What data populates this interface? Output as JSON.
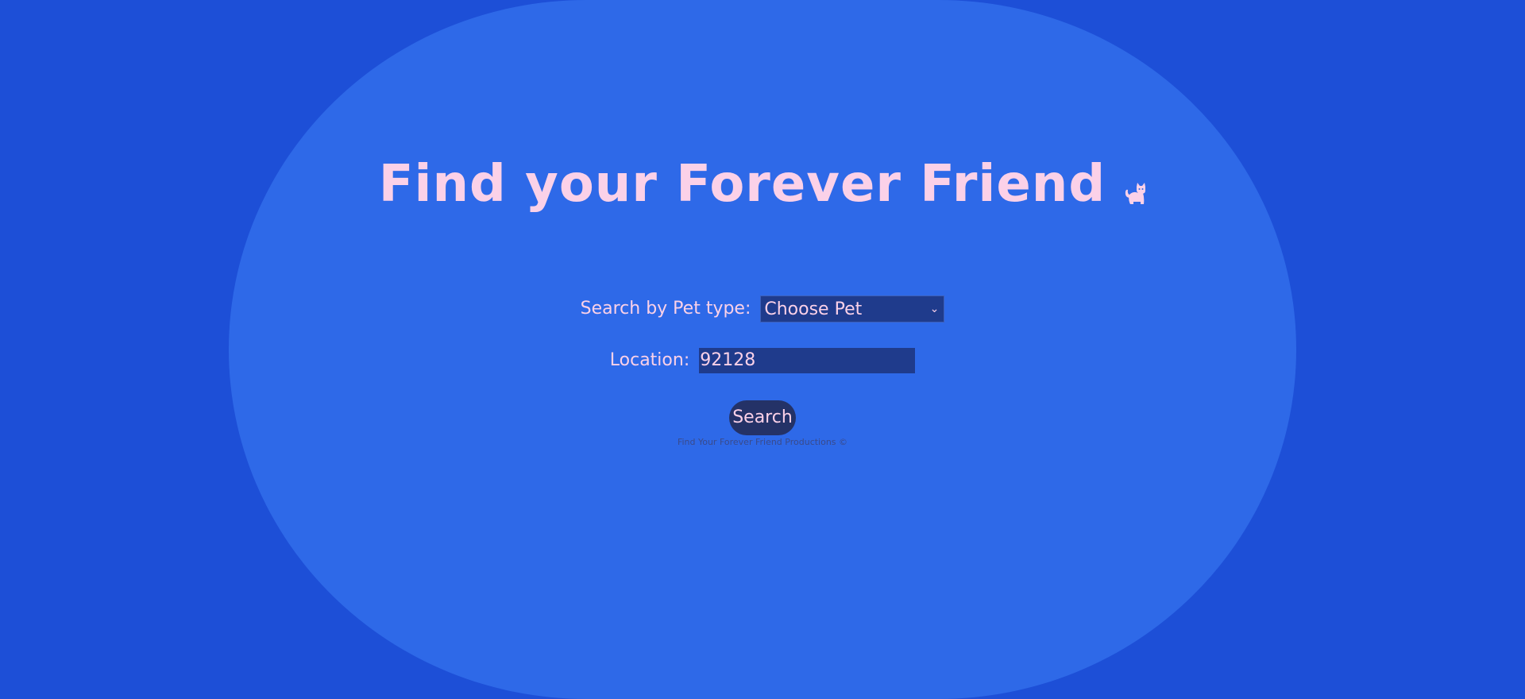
{
  "header": {
    "title": "Find your Forever Friend",
    "icon": "cat-icon"
  },
  "form": {
    "pet_type_label": "Search by Pet type:",
    "pet_type_selected": "Choose Pet",
    "location_label": "Location:",
    "location_value": "92128",
    "search_label": "Search"
  },
  "footer": {
    "text": "Find Your Forever Friend Productions ©"
  },
  "colors": {
    "page_background": "#1d4fd7",
    "blob_background": "#2e69e8",
    "text_pink": "#fbd1e8",
    "field_background": "#1f3b8c",
    "button_background": "#243267"
  }
}
